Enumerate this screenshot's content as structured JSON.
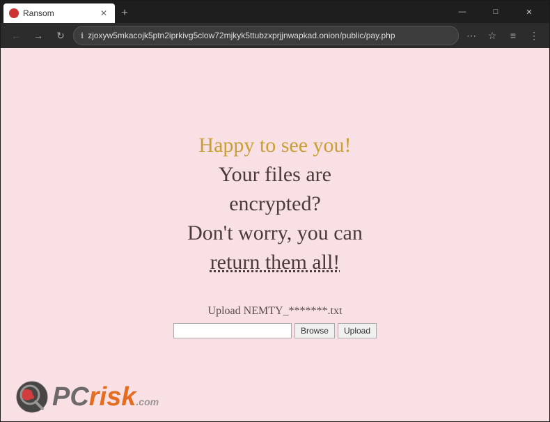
{
  "browser": {
    "title": "Ransomware",
    "tab": {
      "label": "Ransom",
      "favicon_color": "#cc3333"
    },
    "address_bar": {
      "url": "zjoxyw5mkacojk5ptn2iprkivg5clow72mjkyk5ttubzxprjjnwapkad.onion/public/pay.php",
      "lock_icon": "🔒"
    },
    "window_controls": {
      "minimize": "—",
      "maximize": "□",
      "close": "✕"
    },
    "nav_back": "←",
    "nav_forward": "→",
    "new_tab": "+",
    "menu_icon": "⋯"
  },
  "page": {
    "line1": "Happy to see you!",
    "line2": "Your files are",
    "line3": "encrypted?",
    "line4": "Don't worry, you can",
    "line5": "return them all!",
    "upload_label": "Upload NEMTY_*******.txt",
    "browse_btn": "Browse",
    "upload_btn": "Upload"
  },
  "watermark": {
    "pc": "PC",
    "risk": "risk",
    "domain": ".com"
  }
}
